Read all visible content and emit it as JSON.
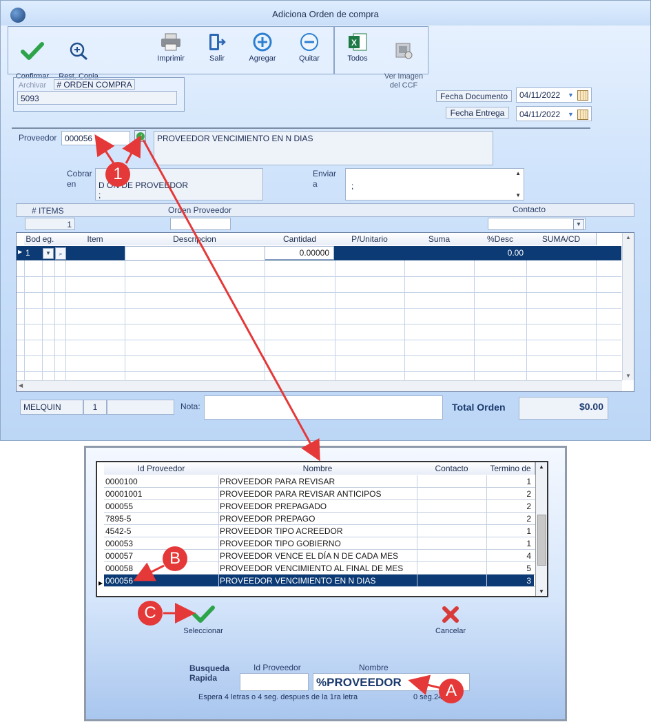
{
  "window": {
    "title": "Adiciona Orden de compra"
  },
  "toolbar": {
    "confirm": "Confirmar\nArchivar",
    "restore": "Rest. Copia\nde Seguridad",
    "print": "Imprimir",
    "exit": "Salir",
    "add": "Agregar",
    "remove": "Quitar",
    "all": "Todos",
    "view_image": "Ver Imagen\ndel CCF"
  },
  "order": {
    "label": "# ORDEN COMPRA",
    "value": "5093",
    "doc_date_label": "Fecha Documento",
    "doc_date": "04/11/2022",
    "delivery_date_label": "Fecha Entrega",
    "delivery_date": "04/11/2022"
  },
  "supplier": {
    "label": "Proveedor",
    "id": "000056",
    "name": "PROVEEDOR VENCIMIENTO EN N DIAS",
    "charge_label": "Cobrar\nen",
    "charge_value": "DIRECCIÓN DE PROVEEDOR\n;",
    "charge_visible": "D        ÓN DE PROVEEDOR\n;",
    "send_label": "Enviar\na",
    "send_value": ";"
  },
  "summary": {
    "items_label": "# ITEMS",
    "items_value": "1",
    "order_supplier_label": "Orden Proveedor",
    "contact_label": "Contacto"
  },
  "items_grid": {
    "columns": [
      "Bod",
      "eg.",
      "",
      "Item",
      "Descripcion",
      "Cantidad",
      "P/Unitario",
      "Suma",
      "%Desc",
      "SUMA/CD"
    ],
    "row": {
      "bod": "1",
      "cantidad": "0.00000",
      "desc": "0.00"
    }
  },
  "footer": {
    "user": "MELQUIN",
    "num": "1",
    "note_label": "Nota:",
    "total_label": "Total Orden",
    "total_value": "$0.00"
  },
  "popup": {
    "columns": [
      "Id Proveedor",
      "Nombre",
      "Contacto",
      "Termino de"
    ],
    "rows": [
      {
        "id": "0000100",
        "name": "PROVEEDOR PARA REVISAR",
        "contact": "",
        "term": "1"
      },
      {
        "id": "00001001",
        "name": "PROVEEDOR PARA REVISAR ANTICIPOS",
        "contact": "",
        "term": "2"
      },
      {
        "id": "000055",
        "name": "PROVEEDOR PREPAGADO",
        "contact": "",
        "term": "2"
      },
      {
        "id": "7895-5",
        "name": "PROVEEDOR PREPAGO",
        "contact": "",
        "term": "2"
      },
      {
        "id": "4542-5",
        "name": "PROVEEDOR TIPO ACREEDOR",
        "contact": "",
        "term": "1"
      },
      {
        "id": "000053",
        "name": "PROVEEDOR TIPO GOBIERNO",
        "contact": "",
        "term": "1"
      },
      {
        "id": "000057",
        "name": "PROVEEDOR VENCE EL DÍA N DE CADA MES",
        "contact": "",
        "term": "4"
      },
      {
        "id": "000058",
        "name": "PROVEEDOR VENCIMIENTO AL FINAL DE MES",
        "contact": "",
        "term": "5"
      },
      {
        "id": "000056",
        "name": "PROVEEDOR VENCIMIENTO EN N DIAS",
        "contact": "",
        "term": "3"
      }
    ],
    "select_label": "Seleccionar",
    "cancel_label": "Cancelar",
    "quick_search_label": "Busqueda\nRapida",
    "id_label": "Id Proveedor",
    "name_label": "Nombre",
    "search_value": "%PROVEEDOR",
    "hint": "Espera 4 letras o 4 seg. despues de la 1ra letra",
    "timer": "0 seg.24"
  },
  "annotations": {
    "one": "1",
    "a": "A",
    "b": "B",
    "c": "C"
  },
  "colors": {
    "selection": "#0b3a74",
    "accent_red": "#e53838",
    "grid_header": "#e7edf7"
  }
}
